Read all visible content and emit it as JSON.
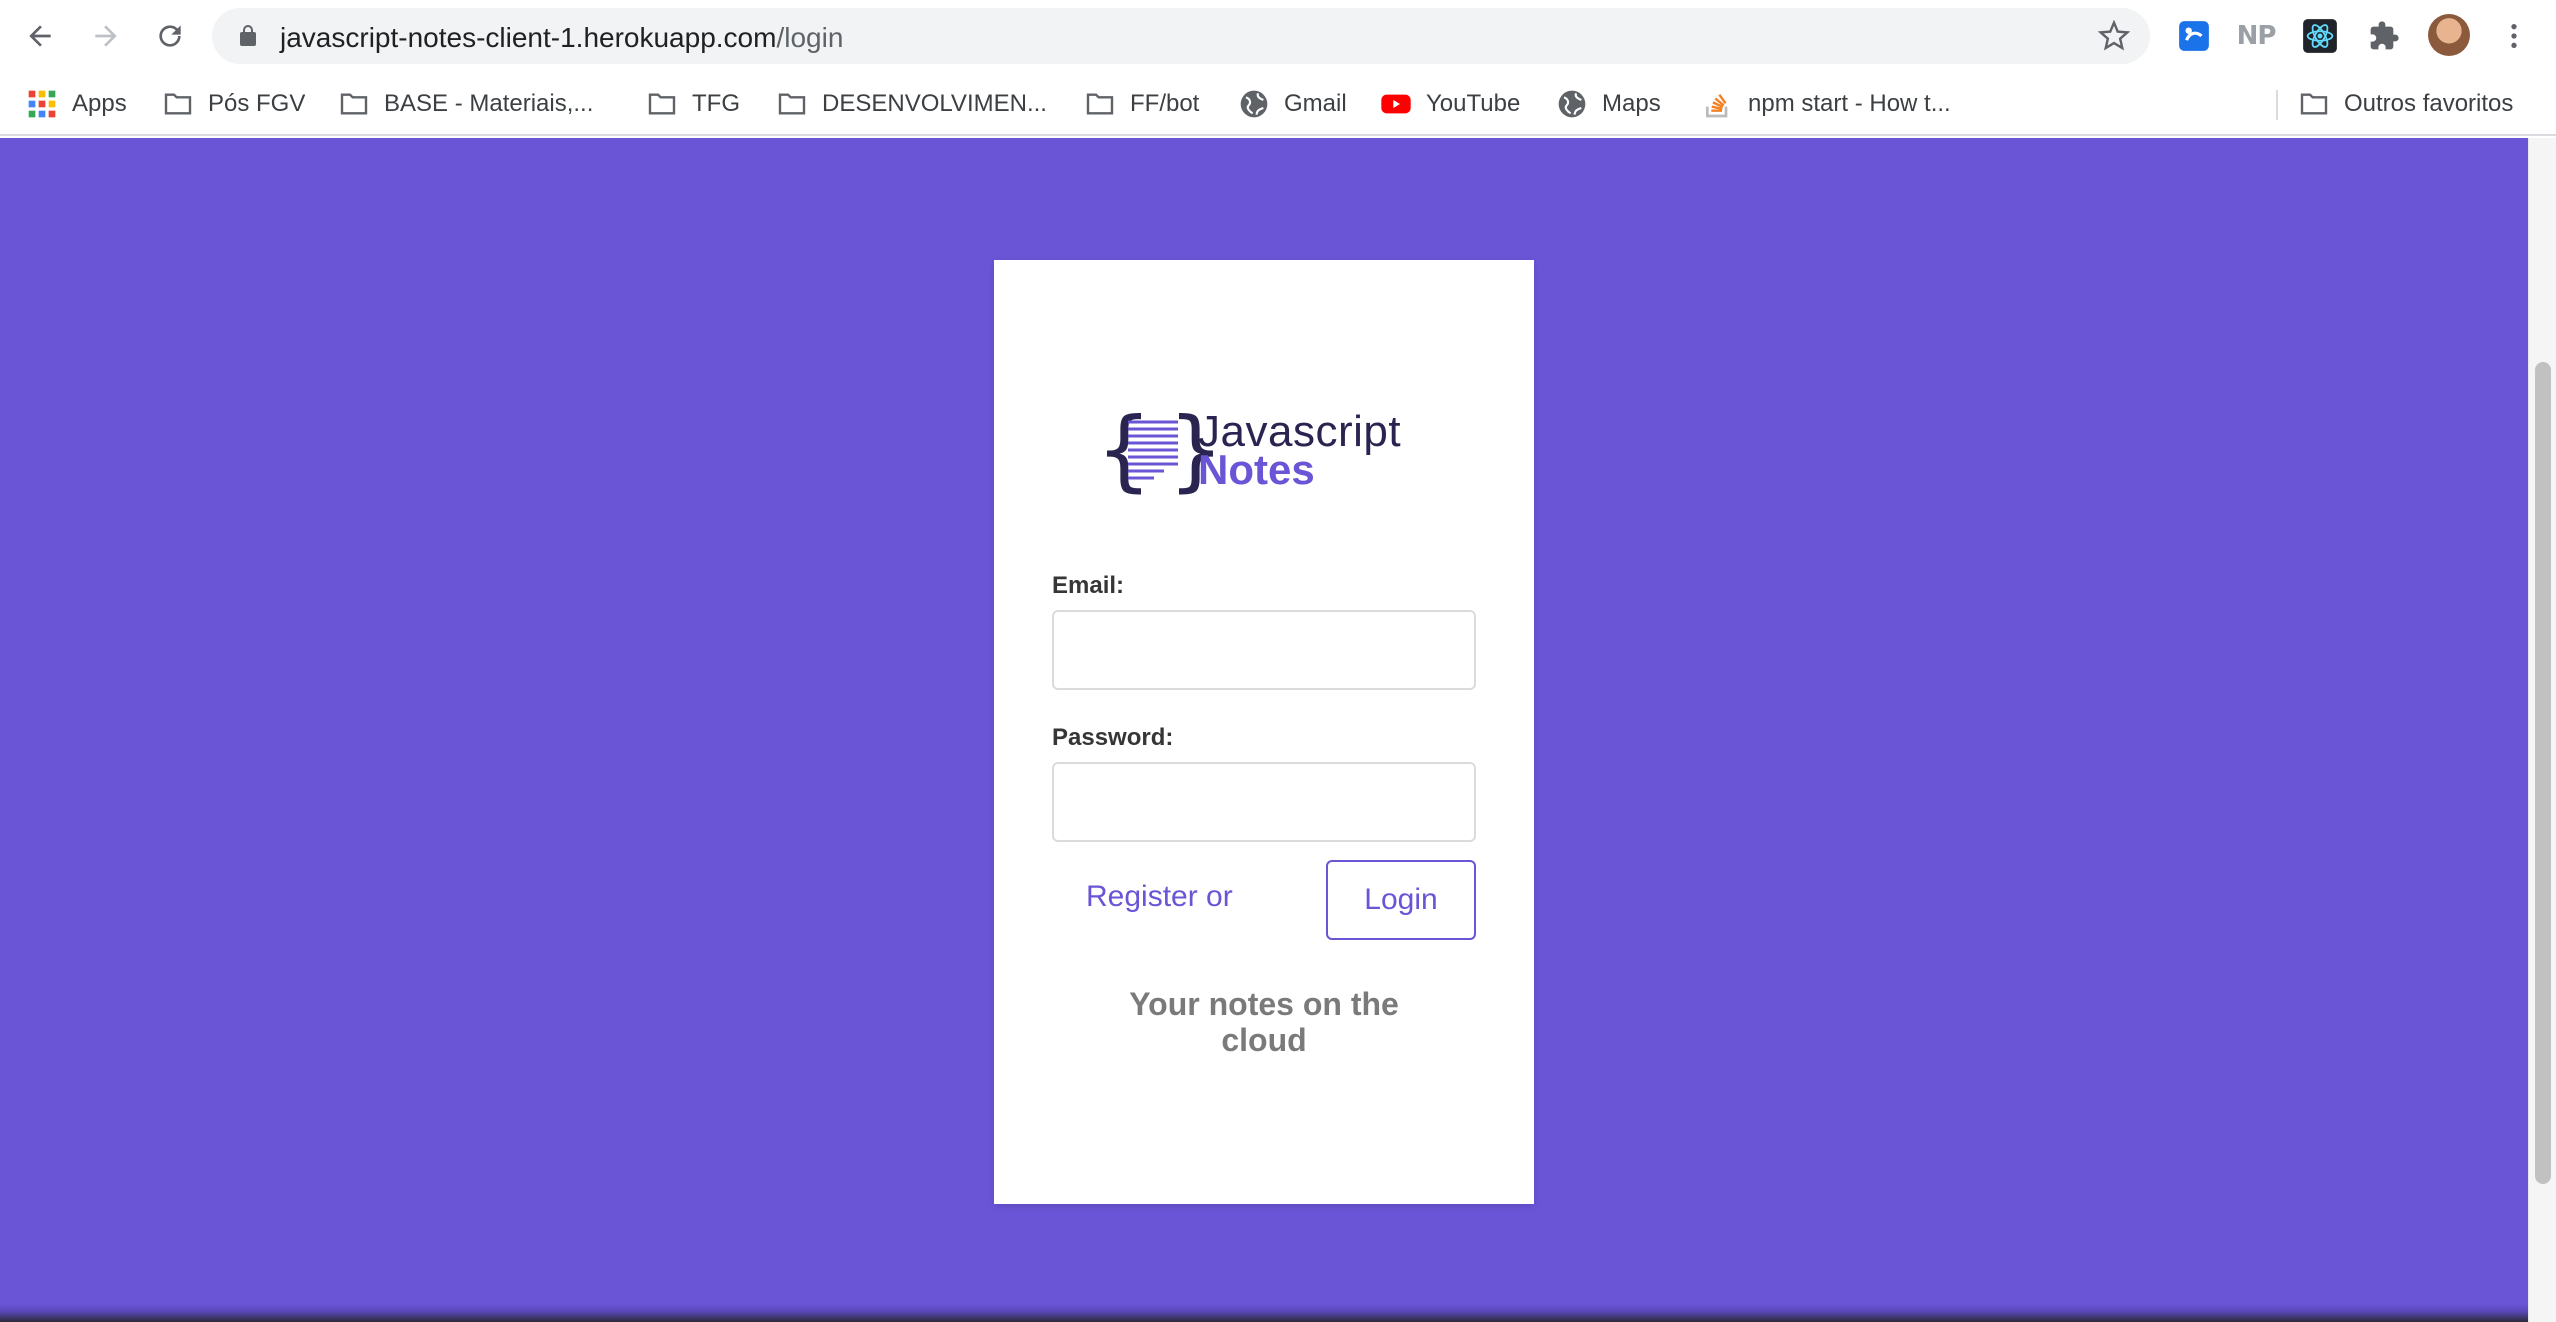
{
  "browser": {
    "url_host": "javascript-notes-client-1.herokuapp.com",
    "url_path": "/login",
    "extensions": [
      "extension-blue-icon",
      "NP",
      "react-devtools-icon",
      "puzzle-icon"
    ],
    "bookmarks": [
      {
        "label": "Apps",
        "icon": "apps-grid-icon"
      },
      {
        "label": "Pós FGV",
        "icon": "folder-icon"
      },
      {
        "label": "BASE - Materiais,...",
        "icon": "folder-icon"
      },
      {
        "label": "TFG",
        "icon": "folder-icon"
      },
      {
        "label": "DESENVOLVIMEN...",
        "icon": "folder-icon"
      },
      {
        "label": "FF/bot",
        "icon": "folder-icon"
      },
      {
        "label": "Gmail",
        "icon": "globe-icon"
      },
      {
        "label": "YouTube",
        "icon": "youtube-icon"
      },
      {
        "label": "Maps",
        "icon": "globe-icon"
      },
      {
        "label": "npm start - How t...",
        "icon": "stackoverflow-icon"
      }
    ],
    "other_bookmarks": "Outros favoritos"
  },
  "page": {
    "logo": {
      "title": "Javascript",
      "subtitle": "Notes"
    },
    "form": {
      "email_label": "Email:",
      "email_value": "",
      "password_label": "Password:",
      "password_value": ""
    },
    "register_link": "Register or",
    "login_button": "Login",
    "tagline_line1": "Your notes on the",
    "tagline_line2": "cloud"
  },
  "colors": {
    "brand": "#6a55d6",
    "logo_dark": "#2a2550",
    "label": "#363636",
    "tagline": "#7a7a7a"
  }
}
